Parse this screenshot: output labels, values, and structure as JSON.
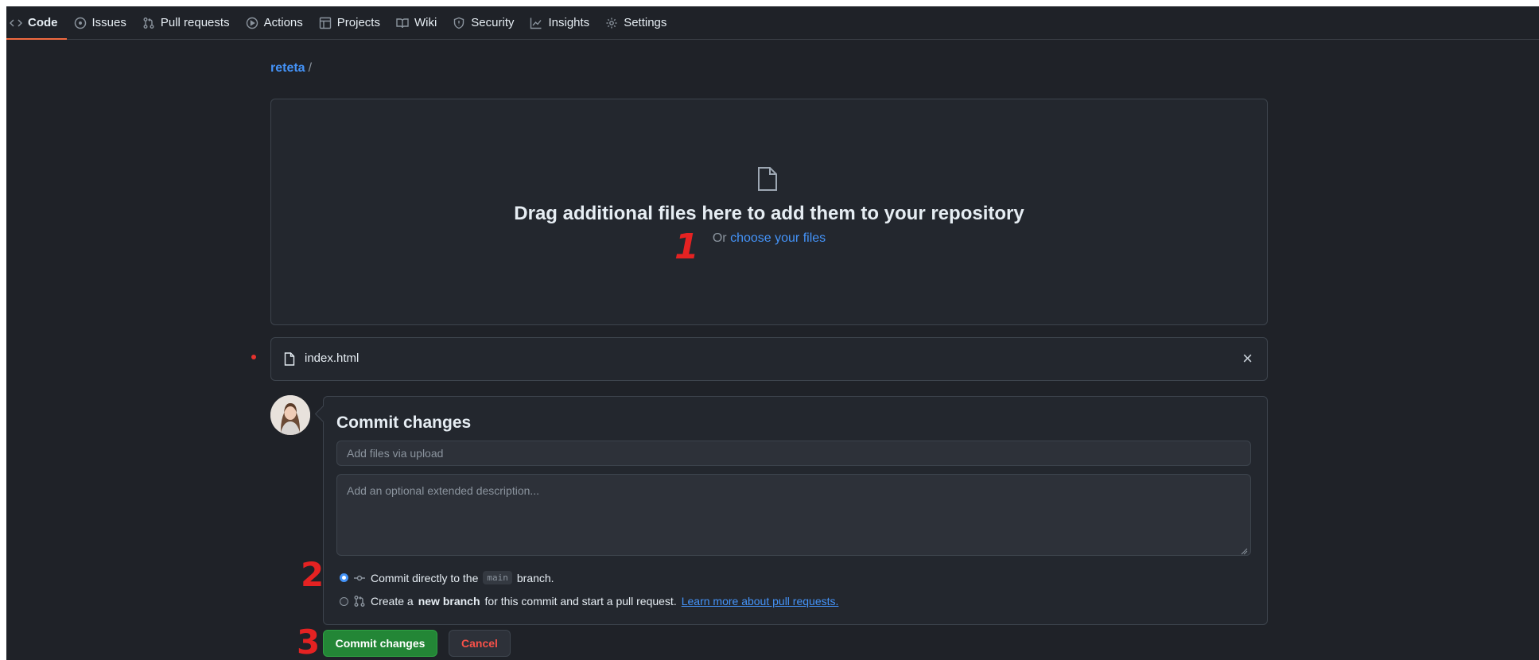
{
  "nav": {
    "items": [
      {
        "label": "Code",
        "icon": "code-icon",
        "active": true
      },
      {
        "label": "Issues",
        "icon": "issue-opened-icon"
      },
      {
        "label": "Pull requests",
        "icon": "git-pull-request-icon"
      },
      {
        "label": "Actions",
        "icon": "play-icon"
      },
      {
        "label": "Projects",
        "icon": "table-icon"
      },
      {
        "label": "Wiki",
        "icon": "book-icon"
      },
      {
        "label": "Security",
        "icon": "shield-icon"
      },
      {
        "label": "Insights",
        "icon": "graph-icon"
      },
      {
        "label": "Settings",
        "icon": "gear-icon"
      }
    ]
  },
  "breadcrumb": {
    "repo": "reteta",
    "separator": "/"
  },
  "dropzone": {
    "title": "Drag additional files here to add them to your repository",
    "or_text": "Or",
    "choose_link": "choose your files"
  },
  "file": {
    "name": "index.html",
    "close": "×"
  },
  "commit": {
    "title": "Commit changes",
    "summary_placeholder": "Add files via upload",
    "description_placeholder": "Add an optional extended description...",
    "option_direct": {
      "before": "Commit directly to the",
      "branch": "main",
      "after": "branch.",
      "checked": true
    },
    "option_new": {
      "before": "Create a",
      "bold": "new branch",
      "after": "for this commit and start a pull request.",
      "link": "Learn more about pull requests.",
      "checked": false
    }
  },
  "buttons": {
    "commit": "Commit changes",
    "cancel": "Cancel"
  },
  "annotations": {
    "one": "1",
    "two": "2",
    "three": "3"
  },
  "colors": {
    "accent": "#4493f8",
    "primary_button": "#238636",
    "danger": "#f85149",
    "annotation": "#e52222",
    "active_tab": "#f06a40"
  }
}
